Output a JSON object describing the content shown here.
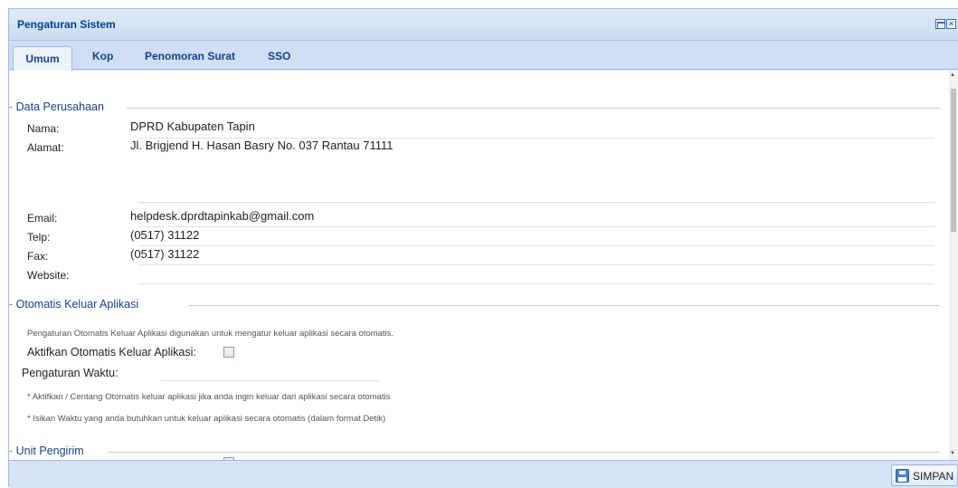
{
  "window": {
    "title": "Pengaturan Sistem"
  },
  "tabs": [
    {
      "label": "Umum",
      "active": true
    },
    {
      "label": "Kop"
    },
    {
      "label": "Penomoran Surat"
    },
    {
      "label": "SSO"
    }
  ],
  "data_perusahaan": {
    "legend": "Data Perusahaan",
    "fields": {
      "nama": {
        "label": "Nama:",
        "value": "DPRD Kabupaten Tapin"
      },
      "alamat": {
        "label": "Alamat:",
        "value": "Jl. Brigjend H. Hasan Basry No. 037 Rantau 71111"
      },
      "email": {
        "label": "Email:",
        "value": "helpdesk.dprdtapinkab@gmail.com"
      },
      "telp": {
        "label": "Telp:",
        "value": "(0517) 31122"
      },
      "fax": {
        "label": "Fax:",
        "value": "(0517) 31122"
      },
      "website": {
        "label": "Website:",
        "value": ""
      }
    }
  },
  "otomatis_keluar": {
    "legend": "Otomatis Keluar Aplikasi",
    "description": "Pengaturan Otomatis Keluar Aplikasi digunakan untuk mengatur keluar aplikasi secara otomatis.",
    "aktifkan_label": "Aktifkan Otomatis Keluar Aplikasi:",
    "aktifkan_checked": false,
    "waktu_label": "Pengaturan Waktu:",
    "waktu_value": "",
    "note1": "* Aktifkan / Centang Otomatis keluar aplikasi jika anda ingin keluar dari aplikasi secara otomatis",
    "note2": "* Isikan Waktu yang anda butuhkan untuk keluar aplikasi secara otomatis (dalam format Detik)"
  },
  "unit_pengirim": {
    "legend": "Unit Pengirim"
  },
  "footer": {
    "save_label": "SIMPAN"
  },
  "icons": {
    "maximize": "maximize-icon",
    "close": "close-icon",
    "save": "save-icon"
  }
}
